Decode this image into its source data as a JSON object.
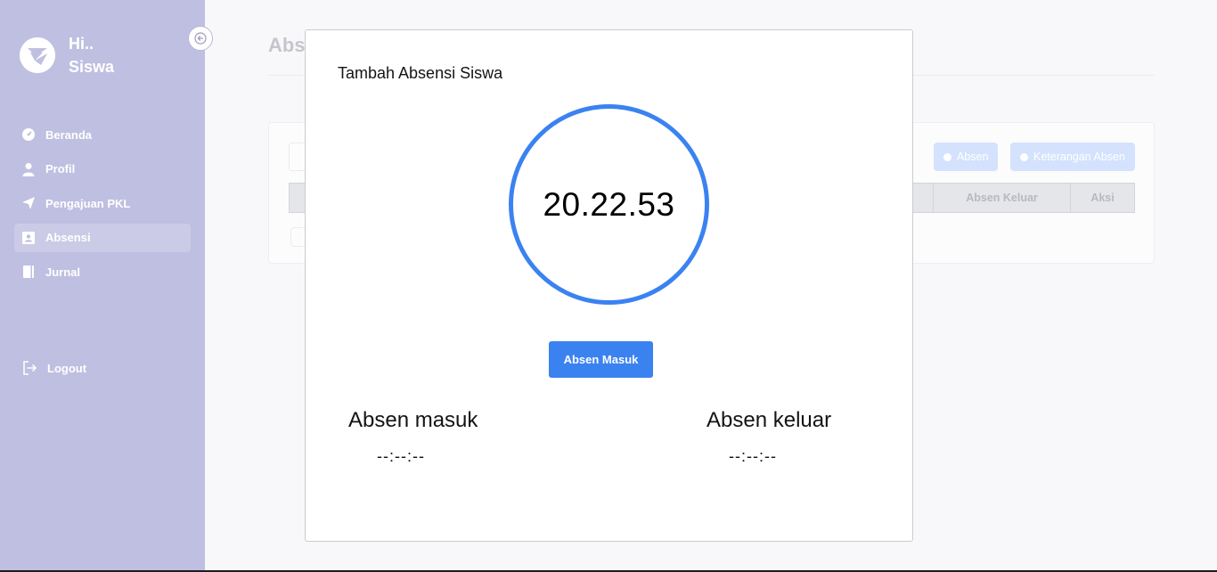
{
  "sidebar": {
    "greeting_line1": "Hi..",
    "greeting_line2": "Siswa",
    "items": [
      {
        "label": "Beranda",
        "icon": "dashboard-icon",
        "active": false
      },
      {
        "label": "Profil",
        "icon": "user-icon",
        "active": false
      },
      {
        "label": "Pengajuan PKL",
        "icon": "send-icon",
        "active": false
      },
      {
        "label": "Absensi",
        "icon": "id-card-icon",
        "active": true
      },
      {
        "label": "Jurnal",
        "icon": "book-icon",
        "active": false
      }
    ],
    "logout_label": "Logout"
  },
  "page": {
    "title": "Abs",
    "buttons": {
      "absen": "Absen",
      "keterangan": "Keterangan Absen"
    },
    "table_headers": [
      "Absen Keluar",
      "Aksi"
    ]
  },
  "modal": {
    "title": "Tambah Absensi Siswa",
    "clock_time": "20.22.53",
    "action_button": "Absen Masuk",
    "in_label": "Absen masuk",
    "in_value": "--:--:--",
    "out_label": "Absen keluar",
    "out_value": "--:--:--"
  },
  "colors": {
    "sidebar_bg": "#bfbfe1",
    "accent": "#3b82f1",
    "faded_button": "#d4e2fd"
  }
}
